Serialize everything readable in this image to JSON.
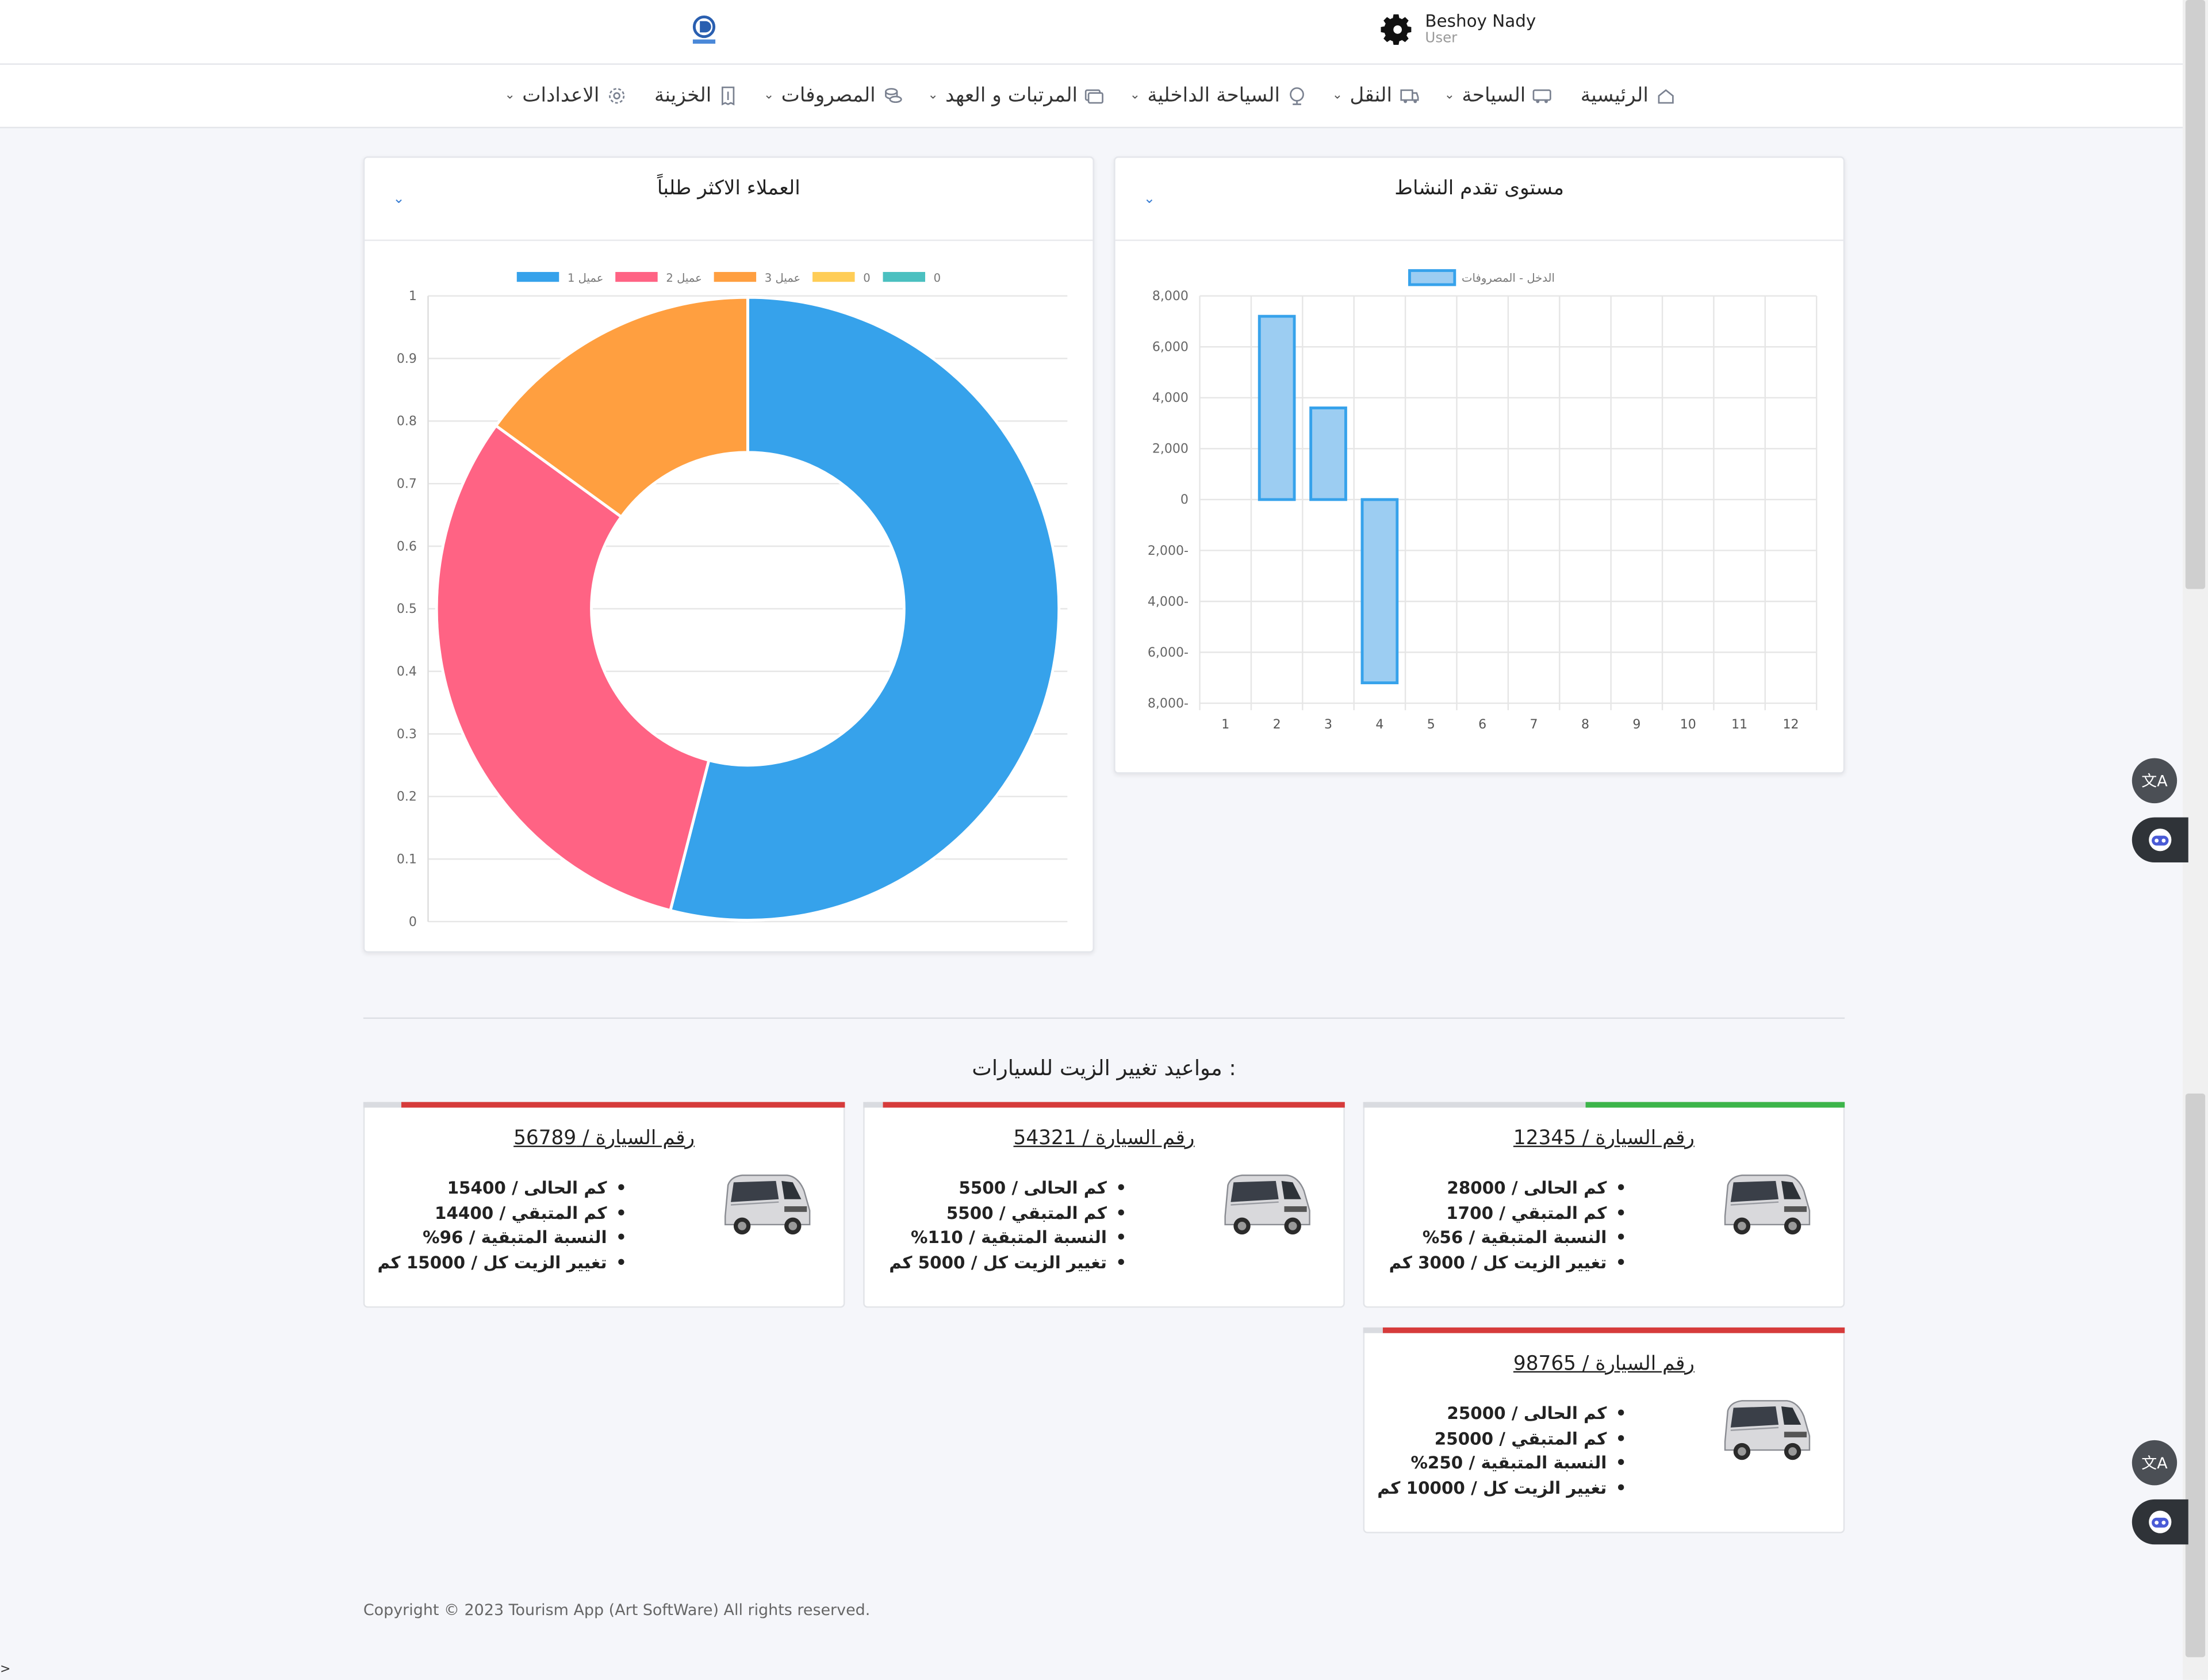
{
  "header": {
    "user_name": "Beshoy Nady",
    "user_role": "User"
  },
  "nav": {
    "items": [
      {
        "label": "الرئيسية",
        "icon": "home-icon",
        "has_dropdown": false
      },
      {
        "label": "السياحة",
        "icon": "bus-icon",
        "has_dropdown": true
      },
      {
        "label": "النقل",
        "icon": "truck-icon",
        "has_dropdown": true
      },
      {
        "label": "السياحة الداخلية",
        "icon": "globe-icon",
        "has_dropdown": true
      },
      {
        "label": "المرتبات و العهد",
        "icon": "cash-icon",
        "has_dropdown": true
      },
      {
        "label": "المصروفات",
        "icon": "coins-icon",
        "has_dropdown": true
      },
      {
        "label": "الخزينة",
        "icon": "receipt-icon",
        "has_dropdown": false
      },
      {
        "label": "الاعدادات",
        "icon": "gear-icon",
        "has_dropdown": true
      }
    ]
  },
  "pie_card": {
    "title": "العملاء الاكثر طلباً"
  },
  "bar_card": {
    "title": "مستوى تقدم النشاط"
  },
  "chart_data": [
    {
      "type": "pie",
      "variant": "doughnut",
      "legend_position": "top",
      "legend": [
        "عميل 1",
        "عميل 2",
        "عميل 3",
        "0",
        "0"
      ],
      "values": [
        54,
        31,
        15,
        0,
        0
      ],
      "colors": [
        "#36a2eb",
        "#ff6384",
        "#ff9f40",
        "#ffcd56",
        "#4bc0c0"
      ],
      "y_ticks": [
        "1",
        "0.9",
        "0.8",
        "0.7",
        "0.6",
        "0.5",
        "0.4",
        "0.3",
        "0.2",
        "0.1",
        "0"
      ],
      "grid": true
    },
    {
      "type": "bar",
      "legend_position": "top",
      "series": [
        {
          "name": "الدخل - المصروفات",
          "values": [
            0,
            7200,
            3600,
            -7200,
            0,
            0,
            0,
            0,
            0,
            0,
            0,
            0
          ],
          "color": "#36a2eb"
        }
      ],
      "categories": [
        "1",
        "2",
        "3",
        "4",
        "5",
        "6",
        "7",
        "8",
        "9",
        "10",
        "11",
        "12"
      ],
      "ylim": [
        -8000,
        8000
      ],
      "y_ticks": [
        "8,000",
        "6,000",
        "4,000",
        "2,000",
        "0",
        "2,000-",
        "4,000-",
        "6,000-",
        "8,000-"
      ],
      "grid": true
    }
  ],
  "oil_section": {
    "title": "مواعيد تغيير الزيت للسيارات :",
    "cars": [
      {
        "title": "رقم السيارة / 12345",
        "fill": 0.56,
        "fill_color": "#3cb54a",
        "lines": [
          "كم الحالى / 28000",
          "كم المتبقي / 1700",
          "النسبة المتبقية / 56%",
          "تغيير الزيت كل / 3000 كم"
        ]
      },
      {
        "title": "رقم السيارة / 54321",
        "fill": 1.0,
        "fill_color": "#d63b3b",
        "lines": [
          "كم الحالى / 5500",
          "كم المتبقي / 5500",
          "النسبة المتبقية / 110%",
          "تغيير الزيت كل / 5000 كم"
        ]
      },
      {
        "title": "رقم السيارة / 56789",
        "fill": 0.96,
        "fill_color": "#d63b3b",
        "lines": [
          "كم الحالى / 15400",
          "كم المتبقي / 14400",
          "النسبة المتبقية / 96%",
          "تغيير الزيت كل / 15000 كم"
        ]
      },
      {
        "title": "رقم السيارة / 98765",
        "fill": 1.0,
        "fill_color": "#d63b3b",
        "lines": [
          "كم الحالى / 25000",
          "كم المتبقي / 25000",
          "النسبة المتبقية / 250%",
          "تغيير الزيت كل / 10000 كم"
        ]
      }
    ]
  },
  "footer": {
    "text": "Copyright © 2023 Tourism App (Art SoftWare) All rights reserved."
  },
  "misc": {
    "cursor_mark": ">",
    "translate_glyph": "文A"
  }
}
